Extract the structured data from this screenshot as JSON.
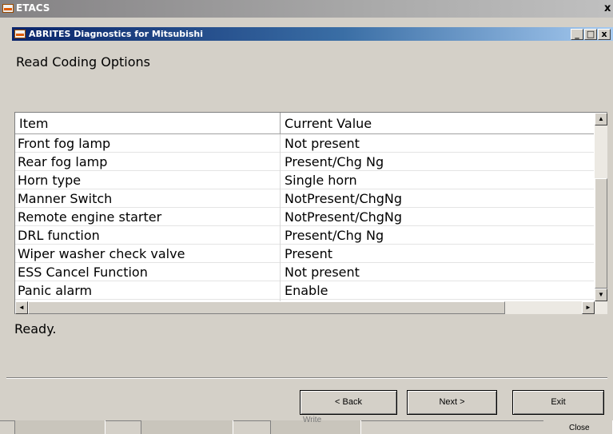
{
  "outer_window": {
    "title": "ETACS",
    "close_label": "x"
  },
  "inner_window": {
    "title": "ABRITES Diagnostics for Mitsubishi",
    "minimize": "_",
    "maximize": "□",
    "close": "x"
  },
  "page": {
    "heading": "Read Coding Options",
    "status": "Ready."
  },
  "table": {
    "columns": [
      "Item",
      "Current Value"
    ],
    "rows": [
      {
        "item": "Front fog lamp",
        "value": "Not present"
      },
      {
        "item": "Rear fog lamp",
        "value": "Present/Chg Ng"
      },
      {
        "item": "Horn type",
        "value": "Single horn"
      },
      {
        "item": "Manner Switch",
        "value": "NotPresent/ChgNg"
      },
      {
        "item": "Remote engine starter",
        "value": "NotPresent/ChgNg"
      },
      {
        "item": "DRL function",
        "value": "Present/Chg Ng"
      },
      {
        "item": "Wiper washer check valve",
        "value": "Present"
      },
      {
        "item": "ESS Cancel Function",
        "value": "Not present"
      },
      {
        "item": "Panic alarm",
        "value": "Enable"
      }
    ],
    "scroll_up_icon": "triangle-up-icon",
    "scroll_down_icon": "triangle-down-icon",
    "scroll_left_icon": "triangle-left-icon",
    "scroll_right_icon": "triangle-right-icon"
  },
  "buttons": {
    "back": "< Back",
    "next": "Next >",
    "exit": "Exit"
  },
  "bottom_strip": {
    "write_label": "Write",
    "close_label": "Close"
  }
}
